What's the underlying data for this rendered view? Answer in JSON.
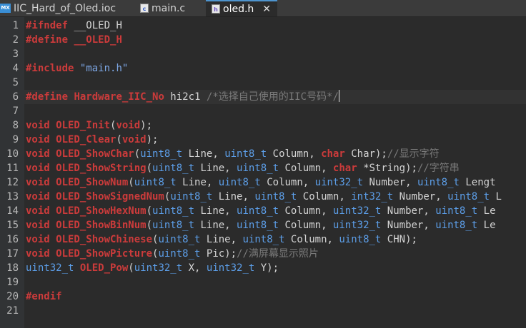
{
  "tabs": [
    {
      "icon": "MX",
      "label": "IIC_Hard_of_Oled.ioc"
    },
    {
      "icon": "c",
      "label": "main.c"
    },
    {
      "icon": "h",
      "label": "oled.h",
      "close": "✕"
    }
  ],
  "line_numbers": [
    "1",
    "2",
    "3",
    "4",
    "5",
    "6",
    "7",
    "8",
    "9",
    "10",
    "11",
    "12",
    "13",
    "14",
    "15",
    "16",
    "17",
    "18",
    "19",
    "20",
    "21"
  ],
  "code": {
    "l1": [
      "#ifndef",
      " __OLED_H"
    ],
    "l2": [
      "#define",
      " __OLED_H"
    ],
    "l4": [
      "#include",
      " \"main.h\""
    ],
    "l6": [
      "#define",
      " Hardware_IIC_No",
      " hi2c1 ",
      "/*选择自己使用的IIC号码*/"
    ],
    "l8": [
      "void",
      " OLED_Init",
      "(",
      "void",
      ");"
    ],
    "l9": [
      "void",
      " OLED_Clear",
      "(",
      "void",
      ");"
    ],
    "l10": [
      "void",
      " OLED_ShowChar",
      "(",
      "uint8_t",
      " Line, ",
      "uint8_t",
      " Column, ",
      "char",
      " Char);",
      "//显示字符"
    ],
    "l11": [
      "void",
      " OLED_ShowString",
      "(",
      "uint8_t",
      " Line, ",
      "uint8_t",
      " Column, ",
      "char",
      " *String);",
      "//字符串"
    ],
    "l12": [
      "void",
      " OLED_ShowNum",
      "(",
      "uint8_t",
      " Line, ",
      "uint8_t",
      " Column, ",
      "uint32_t",
      " Number, ",
      "uint8_t",
      " Lengt"
    ],
    "l13": [
      "void",
      " OLED_ShowSignedNum",
      "(",
      "uint8_t",
      " Line, ",
      "uint8_t",
      " Column, ",
      "int32_t",
      " Number, ",
      "uint8_t",
      " L"
    ],
    "l14": [
      "void",
      " OLED_ShowHexNum",
      "(",
      "uint8_t",
      " Line, ",
      "uint8_t",
      " Column, ",
      "uint32_t",
      " Number, ",
      "uint8_t",
      " Le"
    ],
    "l15": [
      "void",
      " OLED_ShowBinNum",
      "(",
      "uint8_t",
      " Line, ",
      "uint8_t",
      " Column, ",
      "uint32_t",
      " Number, ",
      "uint8_t",
      " Le"
    ],
    "l16": [
      "void",
      " OLED_ShowChinese",
      "(",
      "uint8_t",
      " Line, ",
      "uint8_t",
      " Column, ",
      "uint8_t",
      " CHN);"
    ],
    "l17": [
      "void",
      " OLED_ShowPicture",
      "(",
      "uint8_t",
      " Pic);",
      "//满屏幕显示照片"
    ],
    "l18": [
      "uint32_t",
      " OLED_Pow",
      "(",
      "uint32_t",
      " X, ",
      "uint32_t",
      " Y);"
    ],
    "l20": [
      "#endif"
    ]
  }
}
